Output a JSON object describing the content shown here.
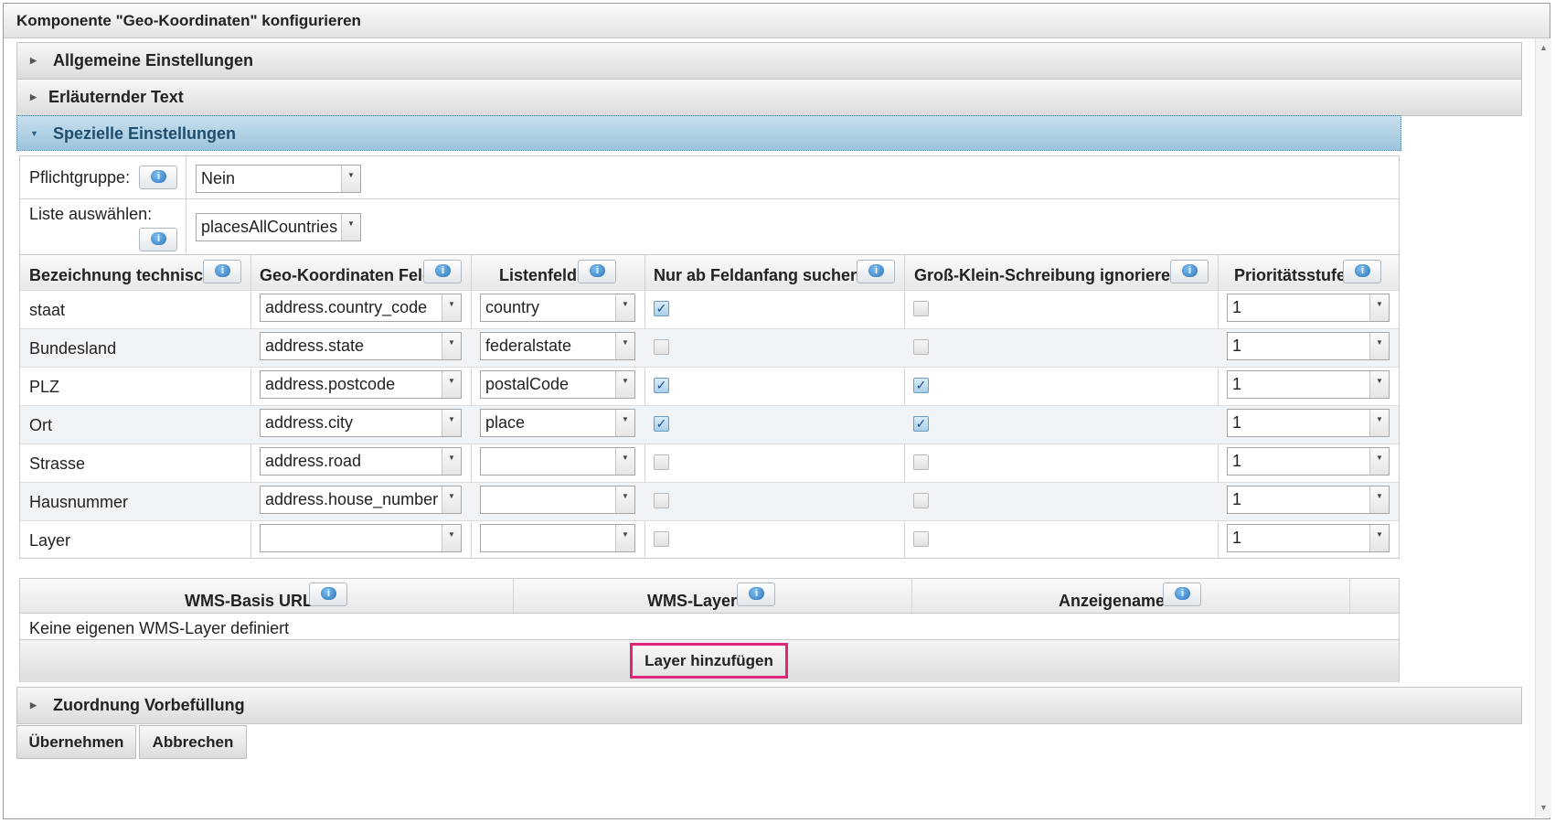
{
  "window": {
    "title": "Komponente \"Geo-Koordinaten\" konfigurieren"
  },
  "sections": {
    "general": "Allgemeine Einstellungen",
    "explain": "Erläuternder Text",
    "special": "Spezielle Einstellungen",
    "prefill": "Zuordnung Vorbefüllung"
  },
  "settings": {
    "required_group_label": "Pflichtgruppe:",
    "required_group_value": "Nein",
    "list_label": "Liste auswählen:",
    "list_value": "placesAllCountries"
  },
  "grid": {
    "headers": [
      "Bezeichnung technisch",
      "Geo-Koordinaten Feld",
      "Listenfeld",
      "Nur ab Feldanfang suchen?",
      "Groß-Klein-Schreibung ignorieren?",
      "Prioritätsstufe"
    ],
    "rows": [
      {
        "name": "staat",
        "geo": "address.country_code",
        "list": "country",
        "start": true,
        "ignore": false,
        "prio": "1"
      },
      {
        "name": "Bundesland",
        "geo": "address.state",
        "list": "federalstate",
        "start": false,
        "ignore": false,
        "prio": "1"
      },
      {
        "name": "PLZ",
        "geo": "address.postcode",
        "list": "postalCode",
        "start": true,
        "ignore": true,
        "prio": "1"
      },
      {
        "name": "Ort",
        "geo": "address.city",
        "list": "place",
        "start": true,
        "ignore": true,
        "prio": "1"
      },
      {
        "name": "Strasse",
        "geo": "address.road",
        "list": "",
        "start": false,
        "ignore": false,
        "prio": "1"
      },
      {
        "name": "Hausnummer",
        "geo": "address.house_number",
        "list": "",
        "start": false,
        "ignore": false,
        "prio": "1"
      },
      {
        "name": "Layer",
        "geo": "",
        "list": "",
        "start": false,
        "ignore": false,
        "prio": "1"
      }
    ]
  },
  "wms": {
    "headers": [
      "WMS-Basis URL",
      "WMS-Layer",
      "Anzeigename"
    ],
    "empty_text": "Keine eigenen WMS-Layer definiert",
    "add_button": "Layer hinzufügen"
  },
  "footer": {
    "apply": "Übernehmen",
    "cancel": "Abbrechen"
  },
  "icons": {
    "info": "info-speech-bubble-icon",
    "dropdown": "chevron-down-icon",
    "expand": "triangle-right-icon",
    "collapse": "triangle-down-icon"
  },
  "colors": {
    "accent_border": "#e0267a",
    "active_section": "#9cc4dc",
    "check_mark": "#1f4f8c"
  }
}
